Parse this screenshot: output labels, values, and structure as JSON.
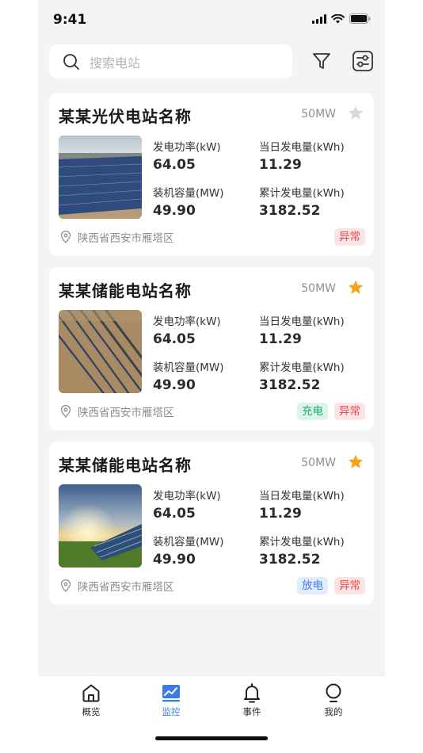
{
  "status_bar": {
    "time": "9:41"
  },
  "search": {
    "placeholder": "搜索电站"
  },
  "stations": [
    {
      "name": "某某光伏电站名称",
      "capacity_label": "50MW",
      "favorited": false,
      "metrics": [
        {
          "label": "发电功率(kW)",
          "value": "64.05"
        },
        {
          "label": "当日发电量(kWh)",
          "value": "11.29"
        },
        {
          "label": "装机容量(MW)",
          "value": "49.90"
        },
        {
          "label": "累计发电量(kWh)",
          "value": "3182.52"
        }
      ],
      "location": "陕西省西安市雁塔区",
      "tags": [
        {
          "text": "异常",
          "kind": "red"
        }
      ]
    },
    {
      "name": "某某储能电站名称",
      "capacity_label": "50MW",
      "favorited": true,
      "metrics": [
        {
          "label": "发电功率(kW)",
          "value": "64.05"
        },
        {
          "label": "当日发电量(kWh)",
          "value": "11.29"
        },
        {
          "label": "装机容量(MW)",
          "value": "49.90"
        },
        {
          "label": "累计发电量(kWh)",
          "value": "3182.52"
        }
      ],
      "location": "陕西省西安市雁塔区",
      "tags": [
        {
          "text": "充电",
          "kind": "green"
        },
        {
          "text": "异常",
          "kind": "red"
        }
      ]
    },
    {
      "name": "某某储能电站名称",
      "capacity_label": "50MW",
      "favorited": true,
      "metrics": [
        {
          "label": "发电功率(kW)",
          "value": "64.05"
        },
        {
          "label": "当日发电量(kWh)",
          "value": "11.29"
        },
        {
          "label": "装机容量(MW)",
          "value": "49.90"
        },
        {
          "label": "累计发电量(kWh)",
          "value": "3182.52"
        }
      ],
      "location": "陕西省西安市雁塔区",
      "tags": [
        {
          "text": "放电",
          "kind": "blue"
        },
        {
          "text": "异常",
          "kind": "red"
        }
      ]
    }
  ],
  "tab_bar": {
    "tabs": [
      {
        "label": "概览",
        "icon": "home-icon",
        "active": false
      },
      {
        "label": "监控",
        "icon": "chart-icon",
        "active": true
      },
      {
        "label": "事件",
        "icon": "bell-icon",
        "active": false
      },
      {
        "label": "我的",
        "icon": "profile-icon",
        "active": false
      }
    ]
  },
  "colors": {
    "accent": "#3a7bea",
    "star_active": "#f7a21b",
    "star_inactive": "#d7d9e0",
    "tag_red": "#e24a4a",
    "tag_green": "#22a86a",
    "tag_blue": "#3f7fe6"
  }
}
